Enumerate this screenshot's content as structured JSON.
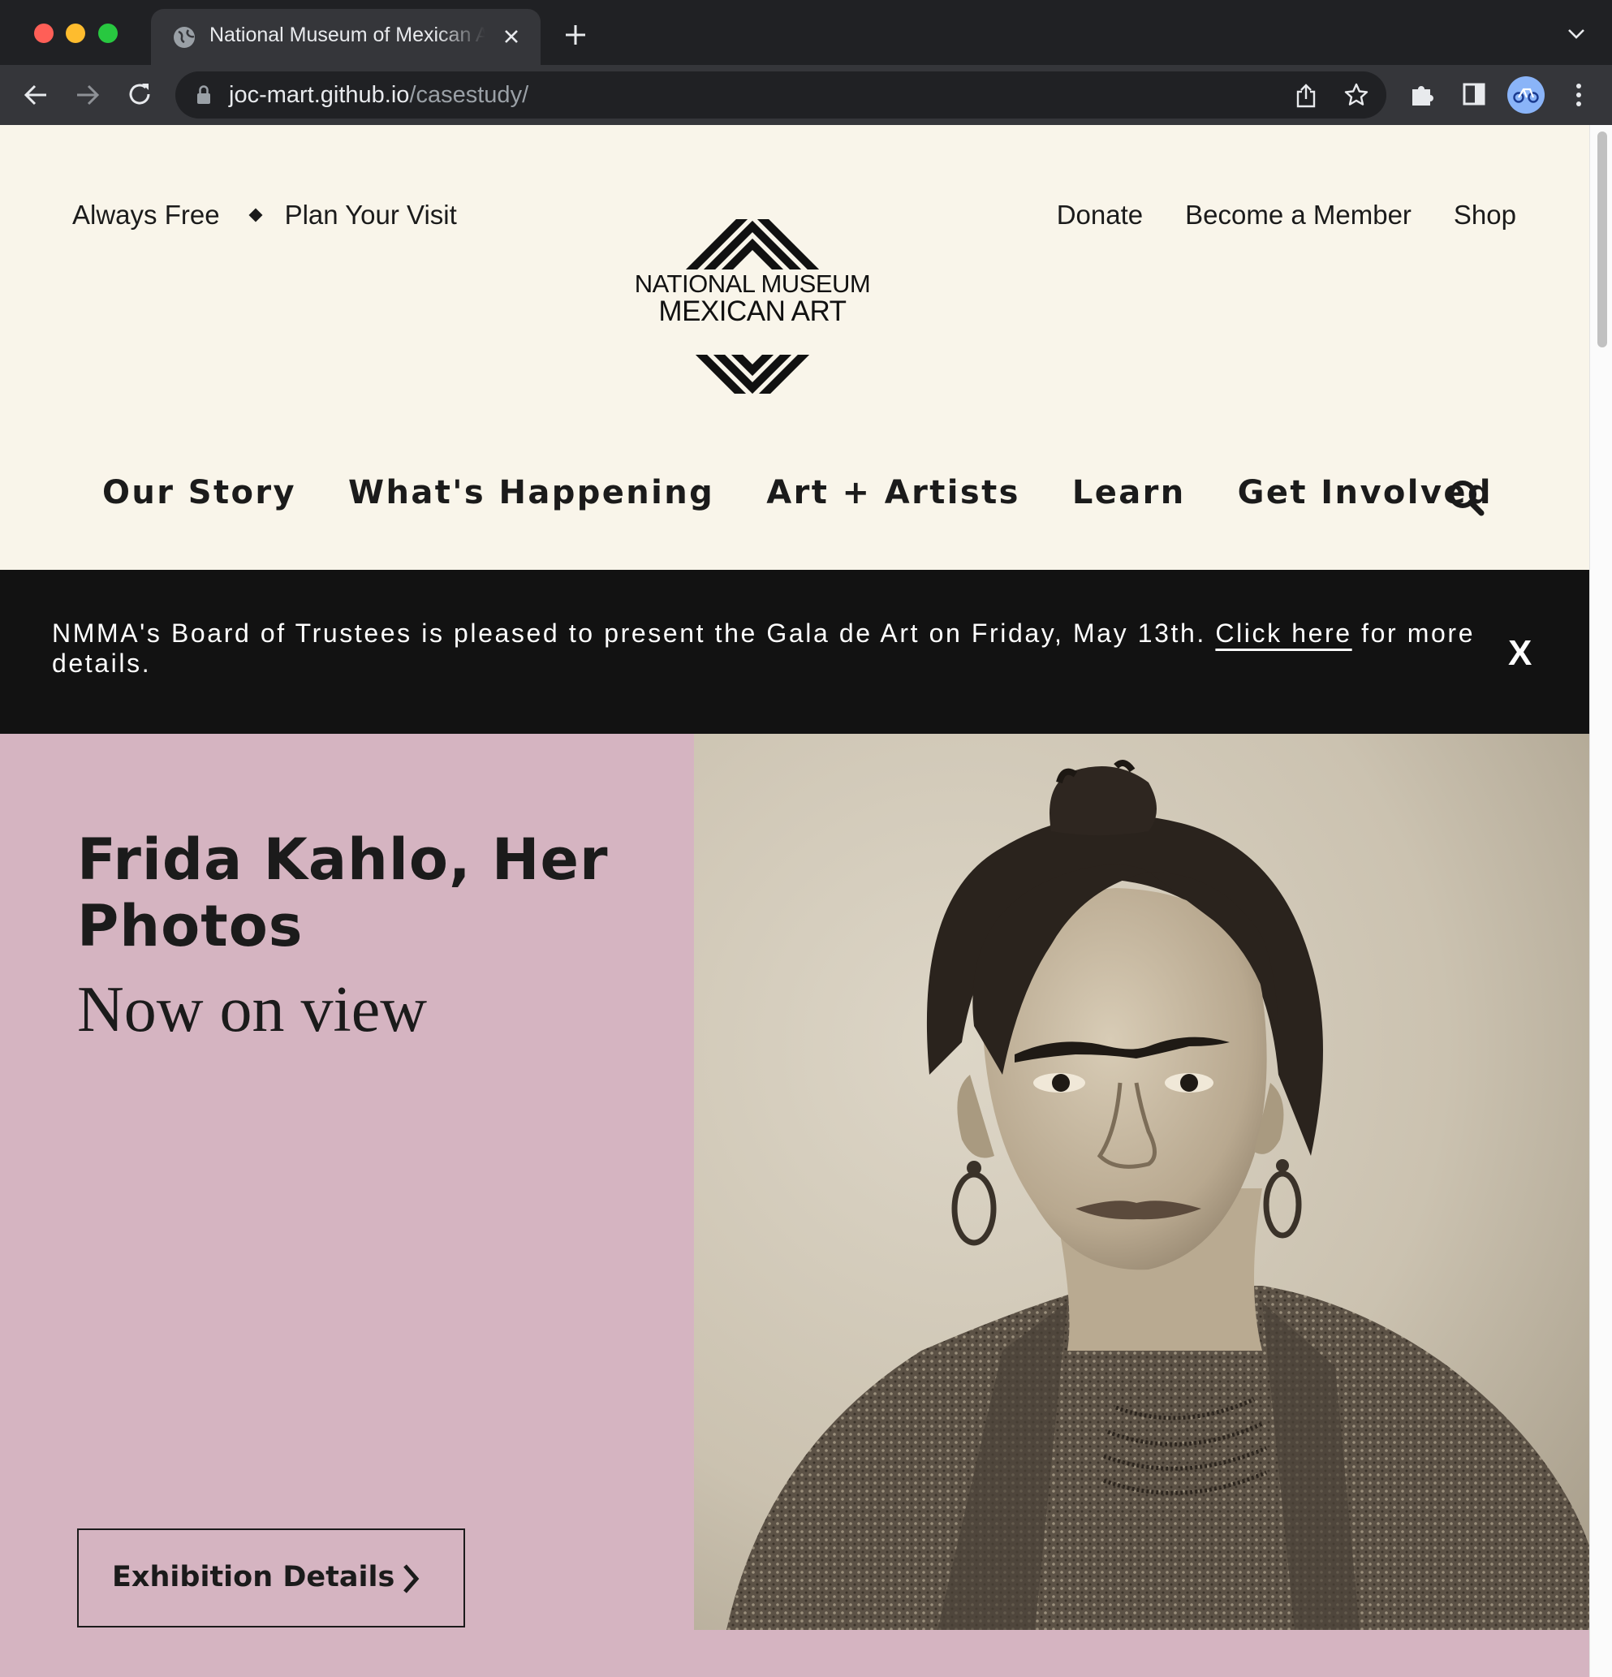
{
  "browser": {
    "tab_title": "National Museum of Mexican Art",
    "url_host": "joc-mart.github.io",
    "url_path": "/casestudy/"
  },
  "utility_nav": {
    "left": [
      "Always Free",
      "Plan Your Visit"
    ],
    "right": [
      "Donate",
      "Become a Member",
      "Shop"
    ]
  },
  "logo": {
    "line1": "NATIONAL MUSEUM OF",
    "line2": "MEXICAN ART"
  },
  "main_nav": [
    "Our Story",
    "What's Happening",
    "Art + Artists",
    "Learn",
    "Get Involved"
  ],
  "banner": {
    "text_before": "NMMA's Board of Trustees is pleased to present the Gala de Art on Friday, May 13th. ",
    "link_text": "Click here",
    "text_after": " for more details.",
    "close_label": "X"
  },
  "hero": {
    "title": "Frida Kahlo, Her Photos",
    "subtitle": "Now on view",
    "button_label": "Exhibition Details"
  },
  "colors": {
    "page_bg": "#f9f5ea",
    "banner_bg": "#121212",
    "hero_bg": "#d5b4c1",
    "text": "#1b1b1b"
  }
}
